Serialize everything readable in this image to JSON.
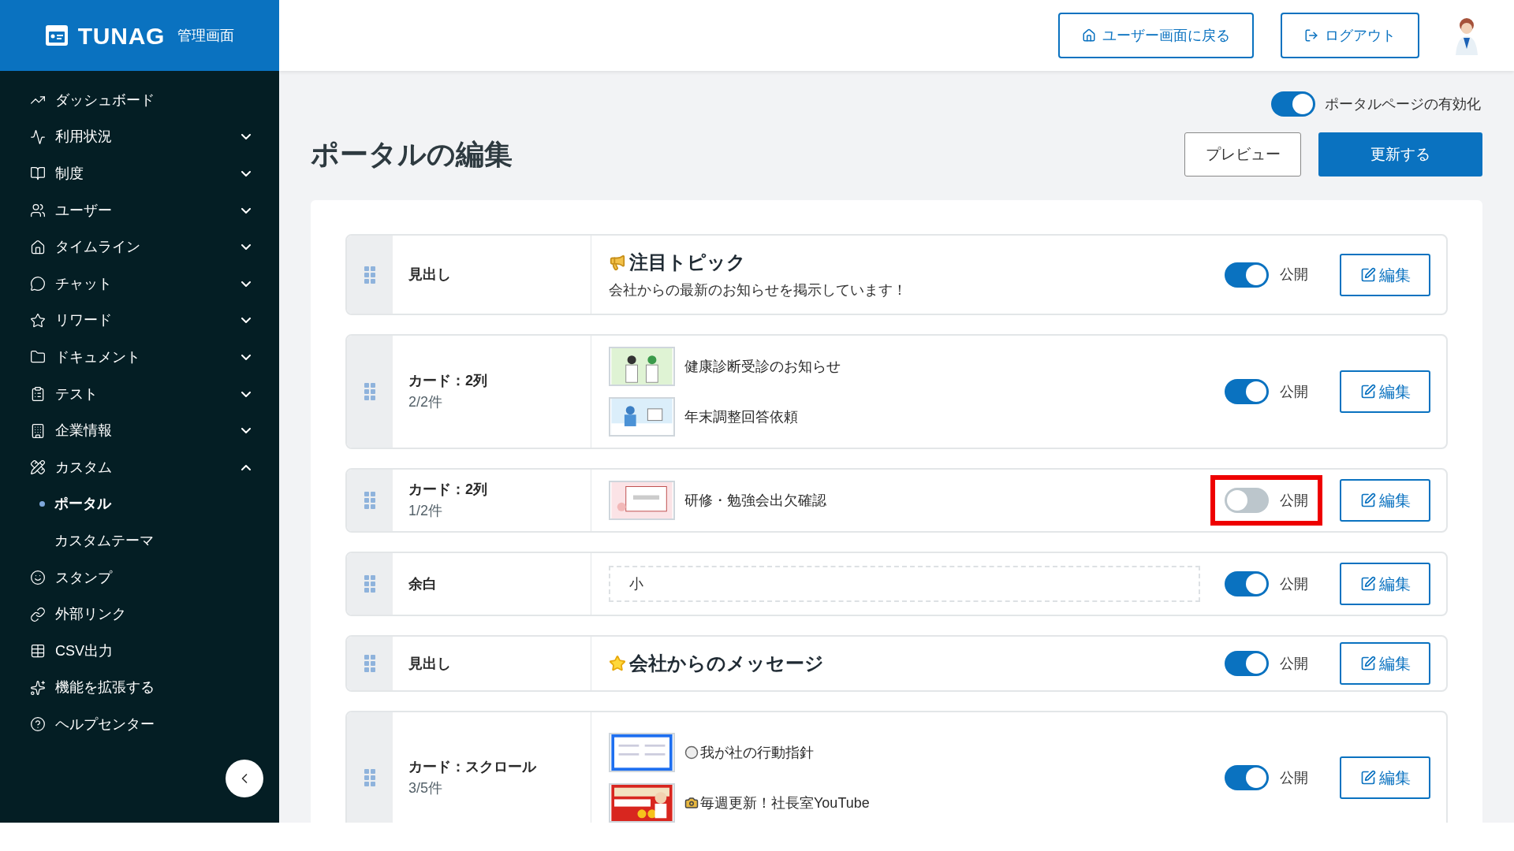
{
  "header": {
    "logo": "TUNAG",
    "logo_subtitle": "管理画面",
    "buttons": [
      {
        "label": "ユーザー画面に戻る"
      },
      {
        "label": "ログアウト"
      }
    ]
  },
  "sidebar": {
    "items": [
      {
        "label": "ダッシュボード",
        "kind": "link"
      },
      {
        "label": "利用状況",
        "kind": "group",
        "expanded": false
      },
      {
        "label": "制度",
        "kind": "group",
        "expanded": false
      },
      {
        "label": "ユーザー",
        "kind": "group",
        "expanded": false
      },
      {
        "label": "タイムライン",
        "kind": "group",
        "expanded": false
      },
      {
        "label": "チャット",
        "kind": "group",
        "expanded": false
      },
      {
        "label": "リワード",
        "kind": "group",
        "expanded": false
      },
      {
        "label": "ドキュメント",
        "kind": "group",
        "expanded": false
      },
      {
        "label": "テスト",
        "kind": "group",
        "expanded": false
      },
      {
        "label": "企業情報",
        "kind": "group",
        "expanded": false
      },
      {
        "label": "カスタム",
        "kind": "group",
        "expanded": true,
        "children": [
          {
            "label": "ポータル",
            "selected": true
          },
          {
            "label": "カスタムテーマ",
            "selected": false
          }
        ]
      },
      {
        "label": "スタンプ",
        "kind": "link"
      },
      {
        "label": "外部リンク",
        "kind": "link"
      },
      {
        "label": "CSV出力",
        "kind": "link"
      },
      {
        "label": "機能を拡張する",
        "kind": "link"
      },
      {
        "label": "ヘルプセンター",
        "kind": "link"
      }
    ]
  },
  "page": {
    "enable_toggle": {
      "label": "ポータルページの有効化",
      "on": true
    },
    "title": "ポータルの編集",
    "buttons": [
      {
        "label": "プレビュー",
        "kind": "secondary"
      },
      {
        "label": "更新する",
        "kind": "primary"
      }
    ]
  },
  "rows": [
    {
      "type_label": "見出し",
      "content": {
        "kind": "heading",
        "title": "注目トピック",
        "subtitle": "会社からの最新のお知らせを掲示しています！"
      },
      "published": true,
      "highlighted": false,
      "toggle_label": "公開",
      "edit_label": "編集"
    },
    {
      "type_label": "カード：2列",
      "count": "2/2件",
      "content": {
        "kind": "cards",
        "items": [
          {
            "title": "健康診断受診のお知らせ"
          },
          {
            "title": "年末調整回答依頼"
          }
        ]
      },
      "published": true,
      "highlighted": false,
      "toggle_label": "公開",
      "edit_label": "編集"
    },
    {
      "type_label": "カード：2列",
      "count": "1/2件",
      "content": {
        "kind": "cards",
        "items": [
          {
            "title": "研修・勉強会出欠確認"
          }
        ]
      },
      "published": false,
      "highlighted": true,
      "toggle_label": "公開",
      "edit_label": "編集"
    },
    {
      "type_label": "余白",
      "content": {
        "kind": "spacer",
        "value": "小"
      },
      "published": true,
      "highlighted": false,
      "toggle_label": "公開",
      "edit_label": "編集"
    },
    {
      "type_label": "見出し",
      "content": {
        "kind": "heading",
        "title": "会社からのメッセージ"
      },
      "published": true,
      "highlighted": false,
      "toggle_label": "公開",
      "edit_label": "編集"
    },
    {
      "type_label": "カード：スクロール",
      "count": "3/5件",
      "content": {
        "kind": "cards",
        "items": [
          {
            "title": "我が社の行動指針"
          },
          {
            "title": "毎週更新！社長室YouTube"
          }
        ]
      },
      "published": true,
      "highlighted": false,
      "toggle_label": "公開",
      "edit_label": "編集"
    }
  ]
}
